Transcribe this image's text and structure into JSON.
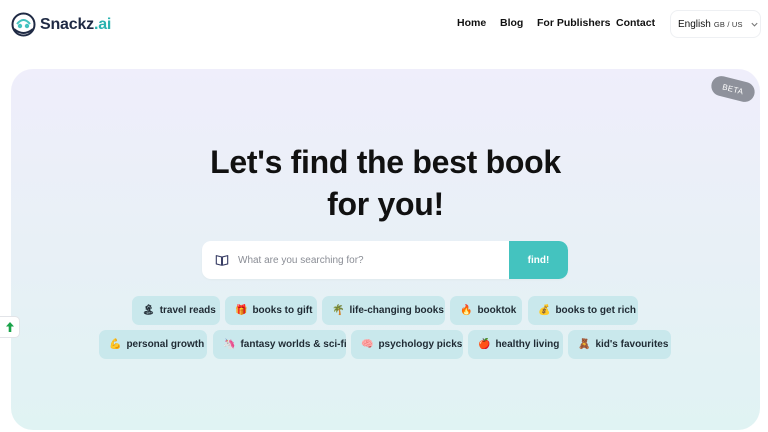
{
  "header": {
    "logo_text": "Snackz",
    "logo_suffix": ".ai",
    "nav": {
      "home": "Home",
      "blog": "Blog",
      "publishers": "For Publishers",
      "contact": "Contact"
    },
    "language": {
      "label": "English",
      "region": "GB / US"
    }
  },
  "hero": {
    "beta": "BETA",
    "headline_line1": "Let's find the best book",
    "headline_line2": "for you!",
    "search": {
      "placeholder": "What are you searching for?",
      "value": "",
      "button": "find!"
    },
    "chips_row1": [
      {
        "emoji": "🏝",
        "label": "travel reads"
      },
      {
        "emoji": "🎁",
        "label": "books to gift"
      },
      {
        "emoji": "🌴",
        "label": "life-changing books"
      },
      {
        "emoji": "🔥",
        "label": "booktok"
      },
      {
        "emoji": "💰",
        "label": "books to get rich"
      }
    ],
    "chips_row2": [
      {
        "emoji": "💪",
        "label": "personal growth"
      },
      {
        "emoji": "🦄",
        "label": "fantasy worlds & sci-fi"
      },
      {
        "emoji": "🧠",
        "label": "psychology picks"
      },
      {
        "emoji": "🍎",
        "label": "healthy living"
      },
      {
        "emoji": "🧸",
        "label": "kid's favourites"
      }
    ]
  },
  "colors": {
    "accent": "#44c3bf",
    "chip_bg": "#c9e8ec",
    "brand_dark": "#1f2a44"
  }
}
